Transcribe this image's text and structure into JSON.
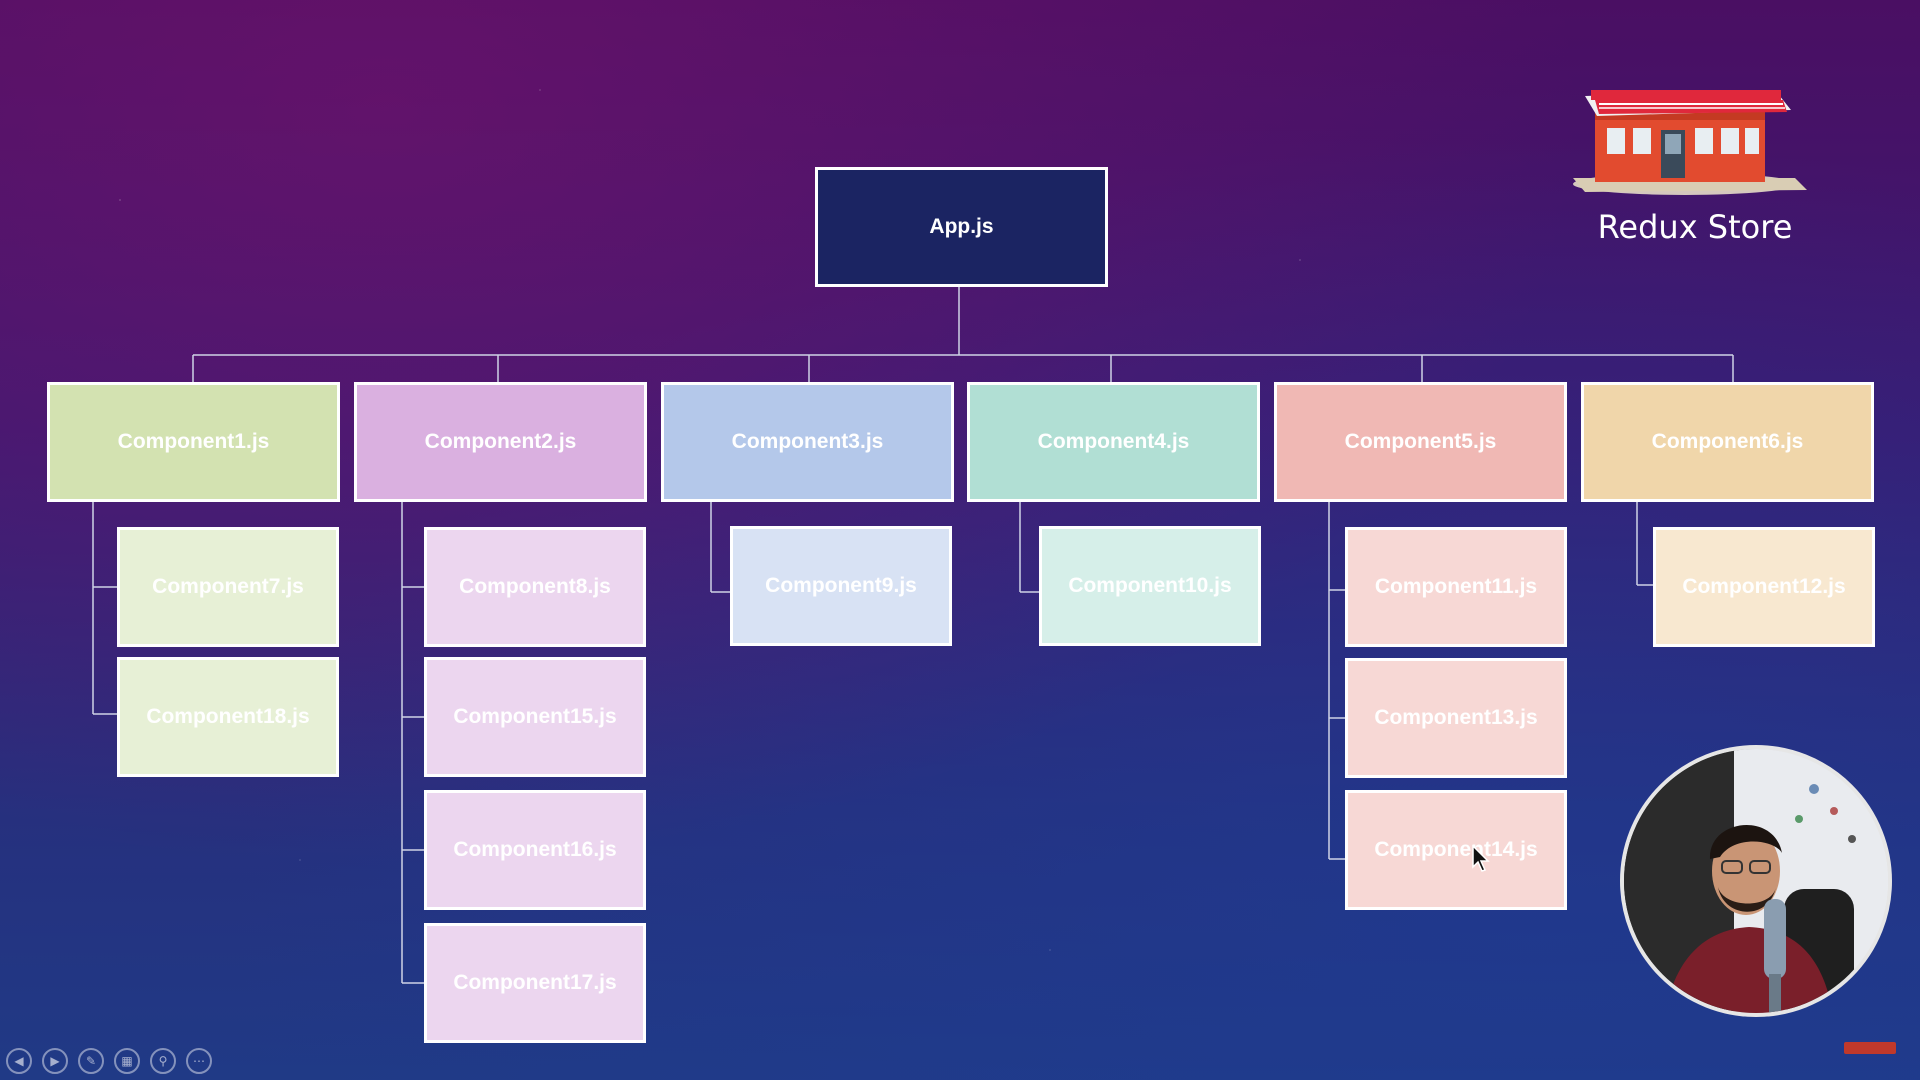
{
  "diagram": {
    "root": {
      "label": "App.js"
    },
    "level1": [
      {
        "label": "Component1.js",
        "color": "#d3e2b1"
      },
      {
        "label": "Component2.js",
        "color": "#dab0e0"
      },
      {
        "label": "Component3.js",
        "color": "#b4c8ea"
      },
      {
        "label": "Component4.js",
        "color": "#b1dfd4"
      },
      {
        "label": "Component5.js",
        "color": "#f0b8b4"
      },
      {
        "label": "Component6.js",
        "color": "#f0d6aa"
      }
    ],
    "children": {
      "c1": [
        "Component7.js",
        "Component18.js"
      ],
      "c2": [
        "Component8.js",
        "Component15.js",
        "Component16.js",
        "Component17.js"
      ],
      "c3": [
        "Component9.js"
      ],
      "c4": [
        "Component10.js"
      ],
      "c5": [
        "Component11.js",
        "Component13.js",
        "Component14.js"
      ],
      "c6": [
        "Component12.js"
      ]
    },
    "child_colors": [
      "#e7f0d6",
      "#ecd6ef",
      "#d8e2f4",
      "#d6efe9",
      "#f7d8d5",
      "#f8e8d0"
    ]
  },
  "store": {
    "label": "Redux Store"
  },
  "toolbar": {
    "icons": [
      "previous-icon",
      "next-icon",
      "pen-icon",
      "slides-icon",
      "zoom-icon",
      "more-icon"
    ]
  }
}
